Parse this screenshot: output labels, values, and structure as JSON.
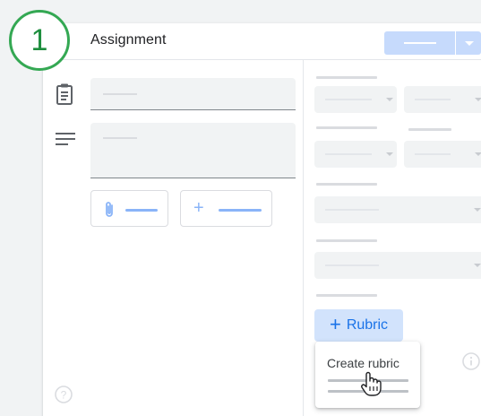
{
  "step_badge": "1",
  "header": {
    "title": "Assignment",
    "assign_button": "",
    "assign_dropdown_icon": "chevron-down-icon"
  },
  "left_icons": [
    "clipboard-icon",
    "notes-icon"
  ],
  "attach_button": {
    "icon": "paperclip-icon",
    "label": ""
  },
  "create_button": {
    "icon": "plus-icon",
    "label": ""
  },
  "rubric": {
    "button_icon": "+",
    "button_label": "Rubric",
    "menu_item": "Create rubric"
  },
  "colors": {
    "badge_green": "#34a853",
    "accent_blue": "#1a73e8",
    "rubric_bg": "#d2e3fc",
    "assign_bg": "#c6dafc"
  }
}
